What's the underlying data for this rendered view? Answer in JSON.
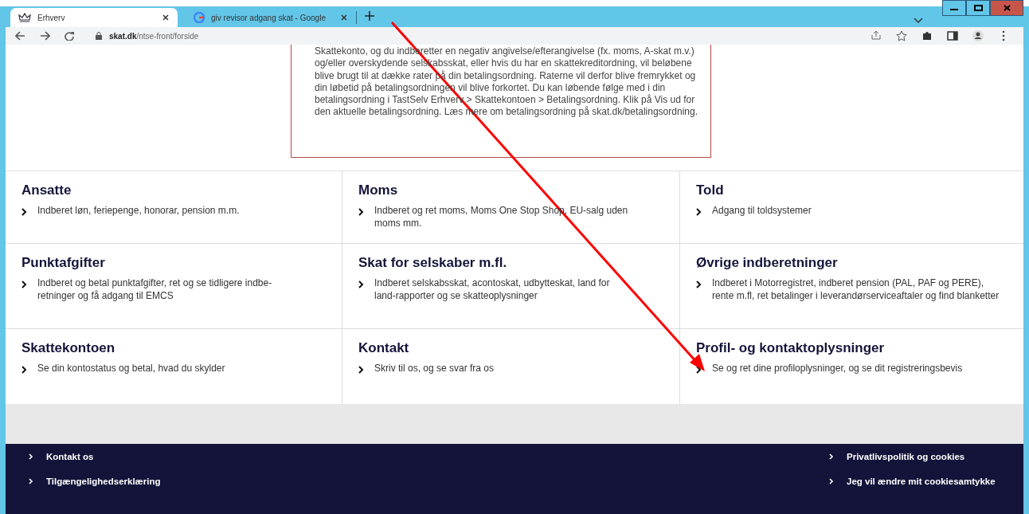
{
  "browser": {
    "tabs": [
      {
        "title": "Erhverv",
        "selected": true
      },
      {
        "title": "giv revisor adgang skat - Google",
        "selected": false
      }
    ],
    "url_host": "skat.dk",
    "url_path": "/ntse-front/forside"
  },
  "notice": "Skattekonto, og du indberetter en negativ angivelse/efterangivelse (fx. moms, A-skat m.v.) og/eller overskydende selskabsskat, eller hvis du har en skattekreditordning, vil beløbene blive brugt til at dække rater på din betalingsordning. Raterne vil derfor blive fremrykket og din løbetid på betalingsordningen vil blive forkortet. Du kan løbende følge med i din betalingsordning i TastSelv Erhverv > Skattekontoen > Betalingsordning. Klik på Vis ud for den aktuelle betalingsordning. Læs mere om betalingsordning på skat.dk/betalingsordning.",
  "sections": [
    {
      "title": "Ansatte",
      "link": "Indberet løn, feriepenge, honorar, pension m.m."
    },
    {
      "title": "Moms",
      "link": "Indberet og ret moms, Moms One Stop Shop, EU-salg uden moms mm."
    },
    {
      "title": "Told",
      "link": "Adgang til toldsystemer"
    },
    {
      "title": "Punktafgifter",
      "link": "Indberet og betal punktafgifter, ret og se tidligere indbe-retninger og få adgang til EMCS"
    },
    {
      "title": "Skat for selskaber m.fl.",
      "link": "Indberet selskabsskat, acontoskat, udbytteskat, land for land-rapporter og se skatteoplysninger"
    },
    {
      "title": "Øvrige indberetninger",
      "link": "Indberet i Motorregistret, indberet pension (PAL, PAF og PERE), rente m.fl, ret betalinger i leverandørserviceaftaler og find blanketter"
    },
    {
      "title": "Skattekontoen",
      "link": "Se din kontostatus og betal, hvad du skylder"
    },
    {
      "title": "Kontakt",
      "link": "Skriv til os, og se svar fra os"
    },
    {
      "title": "Profil- og kontaktoplysninger",
      "link": "Se og ret dine profiloplysninger, og se dit registreringsbevis"
    }
  ],
  "footer": {
    "left": [
      "Kontakt os",
      "Tilgængelighedserklæring"
    ],
    "right": [
      "Privatlivspolitik og cookies",
      "Jeg vil ændre mit cookiesamtykke"
    ]
  }
}
